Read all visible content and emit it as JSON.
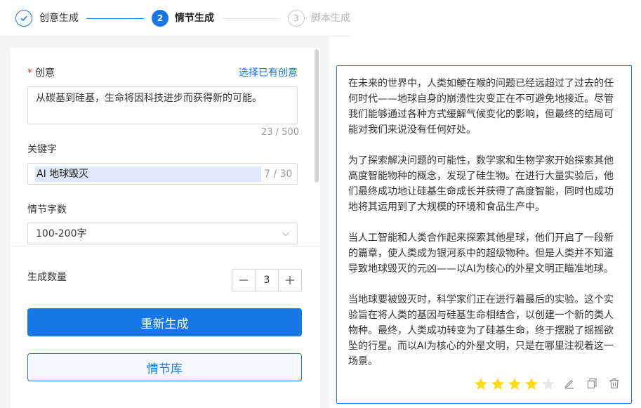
{
  "stepper": {
    "steps": [
      {
        "label": "创意生成",
        "status": "done"
      },
      {
        "label": "情节生成",
        "status": "active",
        "number": "2"
      },
      {
        "label": "脚本生成",
        "status": "pending",
        "number": "3"
      }
    ]
  },
  "form": {
    "idea_label": "创意",
    "select_existing": "选择已有创意",
    "idea_value": "从碳基到硅基，生命将因科技进步而获得新的可能。",
    "idea_counter": "23 / 500",
    "keyword_label": "关键字",
    "keyword_value": "AI 地球毁灭",
    "keyword_counter": "7 / 30",
    "wordcount_label": "情节字数",
    "wordcount_value": "100-200字",
    "quantity_label": "生成数量",
    "quantity_value": "3",
    "regenerate_label": "重新生成",
    "plot_library_label": "情节库"
  },
  "result": {
    "paragraphs": [
      "在未来的世界中，人类如鲠在喉的问题已经远超过了过去的任何时代——地球自身的崩溃性灾变正在不可避免地接近。尽管我们能够通过各种方式缓解气候变化的影响，但最终的结局可能对我们来说没有任何好处。",
      "为了探索解决问题的可能性，数学家和生物学家开始探索其他高度智能物种的概念，发现了硅生物。在进行大量实验后，他们最终成功地让硅基生命成长并获得了高度智能，同时也成功地将其运用到了大规模的环境和食品生产中。",
      "当人工智能和人类合作起来探索其他星球，他们开启了一段新的篇章，使人类成为银河系中的超级物种。但是人类并不知道导致地球毁灭的元凶——以AI为核心的外星文明正瞄准地球。",
      "当地球要被毁灭时，科学家们正在进行着最后的实验。这个实验旨在将人类的基因与硅基生命相结合，以创建一个新的类人物种。最终，人类成功转变为了硅基生命，终于摆脱了摇摇欲坠的行星。而以AI为核心的外星文明，只是在哪里注视着这一场景。"
    ],
    "rating": 4,
    "rating_max": 5
  },
  "colors": {
    "accent": "#1677e6",
    "star_on": "#fadb14",
    "star_off": "#e8e8e8"
  }
}
